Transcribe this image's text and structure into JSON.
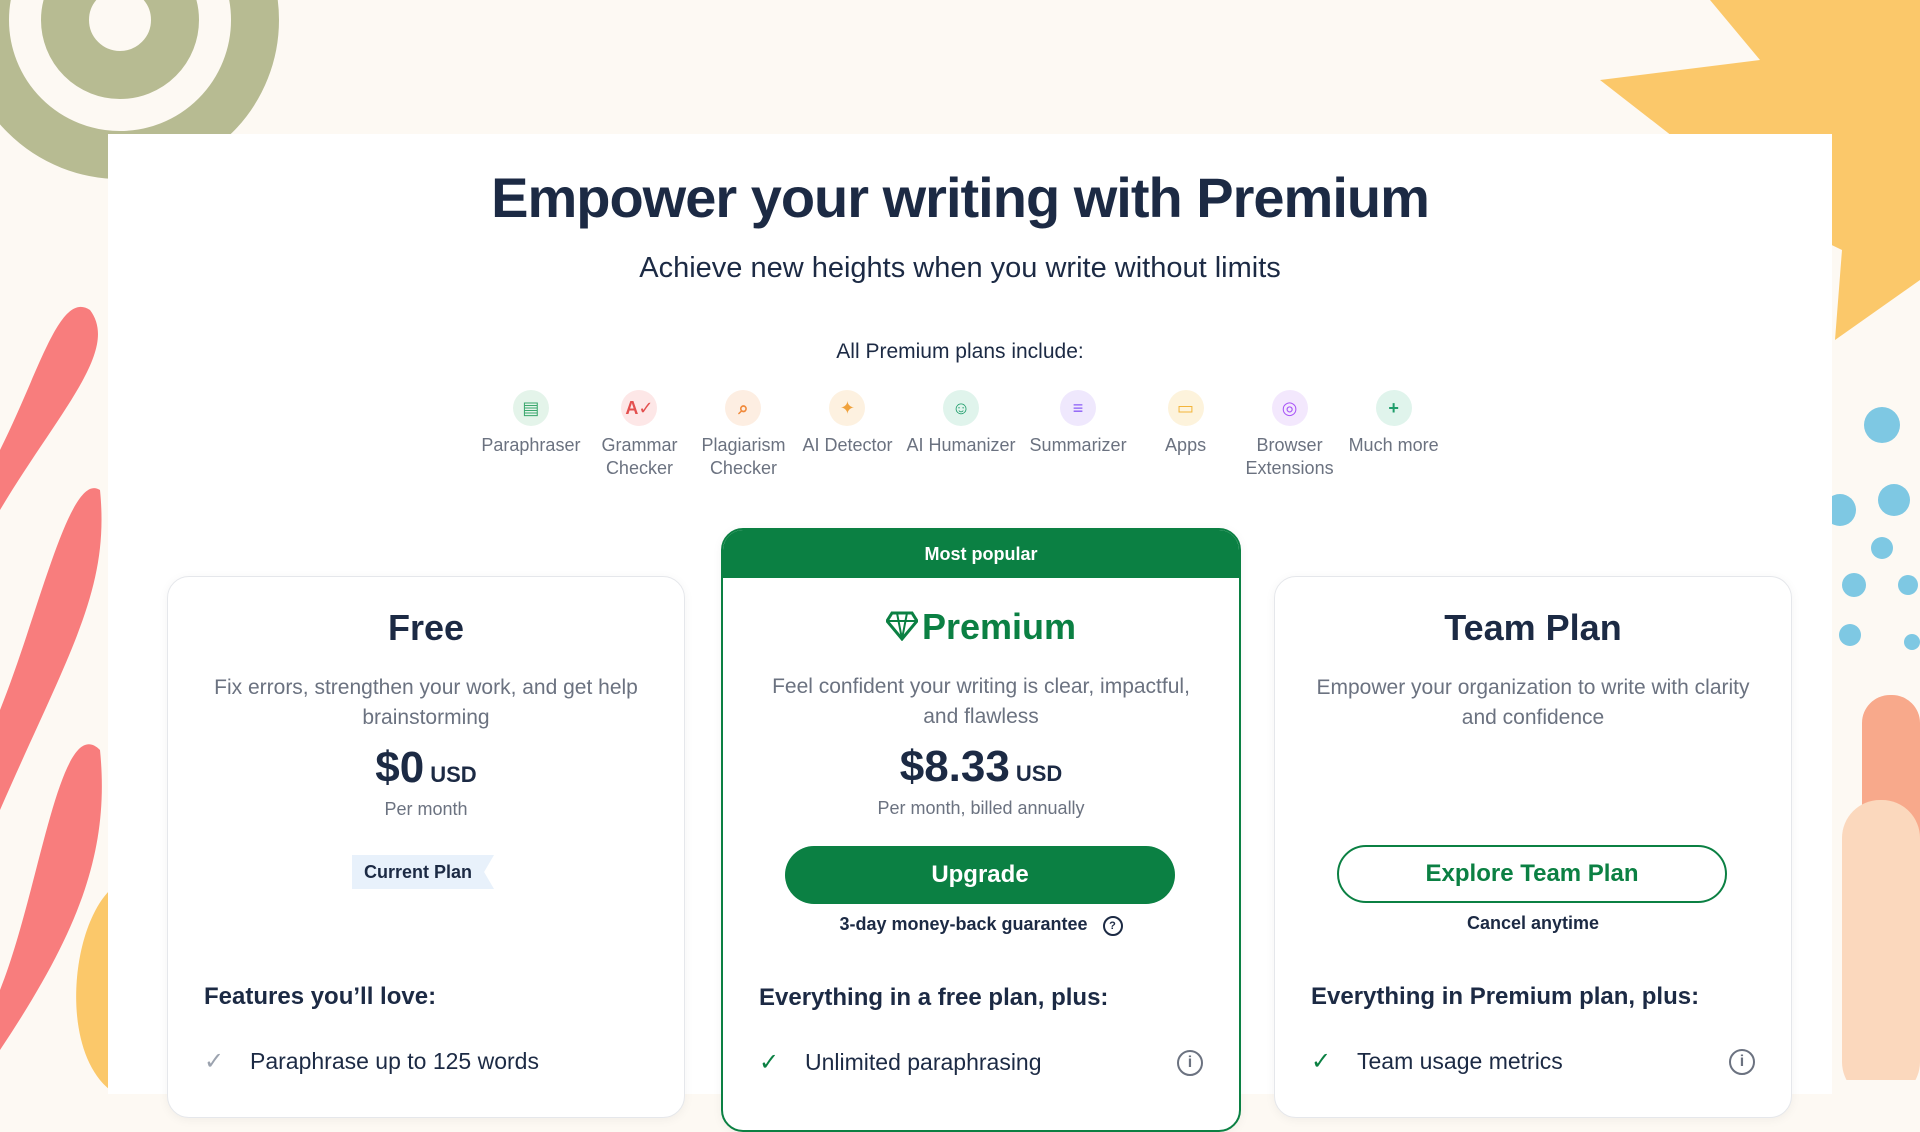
{
  "hero": {
    "title": "Empower your writing with Premium",
    "subtitle": "Achieve new heights when you write without limits"
  },
  "includes": {
    "title": "All Premium plans include:",
    "items": [
      {
        "label": "Paraphraser",
        "icon": "paraphraser-icon",
        "color": "#3aa76d"
      },
      {
        "label": "Grammar\nChecker",
        "icon": "grammar-checker-icon",
        "color": "#e3504f"
      },
      {
        "label": "Plagiarism\nChecker",
        "icon": "plagiarism-checker-icon",
        "color": "#f08a3c"
      },
      {
        "label": "AI Detector",
        "icon": "ai-detector-icon",
        "color": "#f0a23c"
      },
      {
        "label": "AI Humanizer",
        "icon": "ai-humanizer-icon",
        "color": "#1f9d6b"
      },
      {
        "label": "Summarizer",
        "icon": "summarizer-icon",
        "color": "#8b5cf6"
      },
      {
        "label": "Apps",
        "icon": "apps-icon",
        "color": "#f3b43a"
      },
      {
        "label": "Browser\nExtensions",
        "icon": "browser-extensions-icon",
        "color": "#a855f7"
      },
      {
        "label": "Much more",
        "icon": "plus-icon",
        "color": "#1f9d6b"
      }
    ]
  },
  "plans": {
    "free": {
      "name": "Free",
      "description": "Fix errors, strengthen your work, and get help brainstorming",
      "price": "$0",
      "currency": "USD",
      "price_note": "Per month",
      "current_plan_label": "Current Plan",
      "features_heading": "Features you’ll love:",
      "features": [
        "Paraphrase up to 125 words"
      ]
    },
    "premium": {
      "badge": "Most popular",
      "name": "Premium",
      "description": "Feel confident your writing is clear, impactful, and flawless",
      "price": "$8.33",
      "currency": "USD",
      "price_note": "Per month, billed annually",
      "button_label": "Upgrade",
      "guarantee": "3-day money-back guarantee",
      "features_heading": "Everything in a free plan, plus:",
      "features": [
        "Unlimited paraphrasing"
      ]
    },
    "team": {
      "name": "Team Plan",
      "description": "Empower your organization to write with clarity and confidence",
      "button_label": "Explore Team Plan",
      "cancel_note": "Cancel anytime",
      "features_heading": "Everything in Premium plan, plus:",
      "features": [
        "Team usage metrics"
      ]
    }
  },
  "colors": {
    "brand_green": "#0b8043",
    "text_dark": "#1c2a44",
    "text_muted": "#6b7280"
  }
}
